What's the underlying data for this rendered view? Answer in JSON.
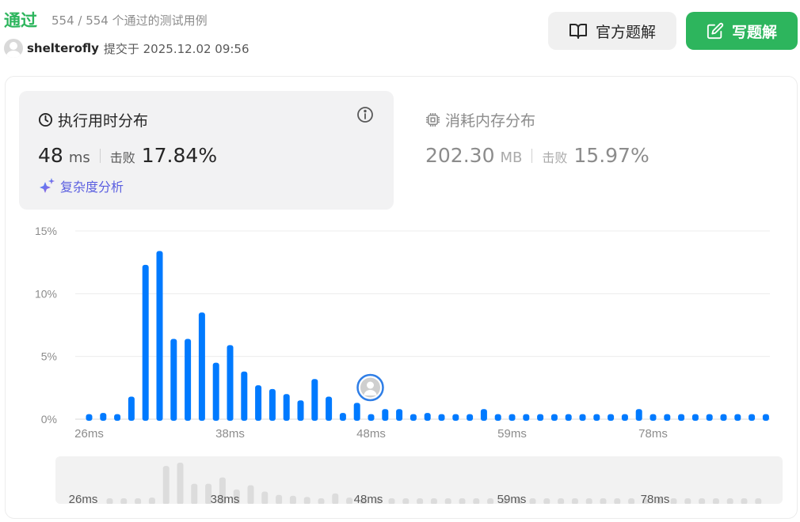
{
  "header": {
    "status": "通过",
    "passed": "554 / 554 个通过的测试用例",
    "username": "shelterofly",
    "submit_time": "提交于 2025.12.02 09:56",
    "official_solution": "官方题解",
    "write_solution": "写题解"
  },
  "runtime": {
    "title": "执行用时分布",
    "value": "48",
    "unit": "ms",
    "beat_label": "击败",
    "beat_value": "17.84%",
    "complexity_label": "复杂度分析"
  },
  "memory": {
    "title": "消耗内存分布",
    "value": "202.30",
    "unit": "MB",
    "beat_label": "击败",
    "beat_value": "15.97%"
  },
  "colors": {
    "accept": "#2db55d",
    "bar": "#007aff",
    "mini_bar": "#dcdcdc",
    "complexity": "#5a5ee0"
  },
  "icons": {
    "official": "book-open-icon",
    "write": "edit-icon",
    "runtime": "clock-icon",
    "info": "info-icon",
    "memory": "chip-icon",
    "complexity": "sparkle-icon",
    "user_marker": "user-avatar-icon"
  },
  "chart_data": {
    "type": "bar",
    "ylabel": "",
    "yticks": [
      "0%",
      "5%",
      "10%",
      "15%"
    ],
    "ylim": [
      0,
      15
    ],
    "x_tick_labels": [
      "26ms",
      "38ms",
      "48ms",
      "59ms",
      "78ms"
    ],
    "values": [
      0.4,
      0.5,
      0.4,
      1.8,
      12.3,
      13.4,
      6.4,
      6.4,
      8.5,
      4.5,
      5.9,
      3.8,
      2.7,
      2.4,
      2.0,
      1.5,
      3.2,
      1.8,
      0.5,
      1.3,
      0.4,
      0.8,
      0.8,
      0.4,
      0.5,
      0.4,
      0.4,
      0.4,
      0.8,
      0.4,
      0.4,
      0.4,
      0.4,
      0.4,
      0.4,
      0.4,
      0.4,
      0.4,
      0.4,
      0.8,
      0.4,
      0.4,
      0.4,
      0.4,
      0.4,
      0.4,
      0.4,
      0.4,
      0.4
    ],
    "user_bar_index": 20,
    "grid": true
  }
}
